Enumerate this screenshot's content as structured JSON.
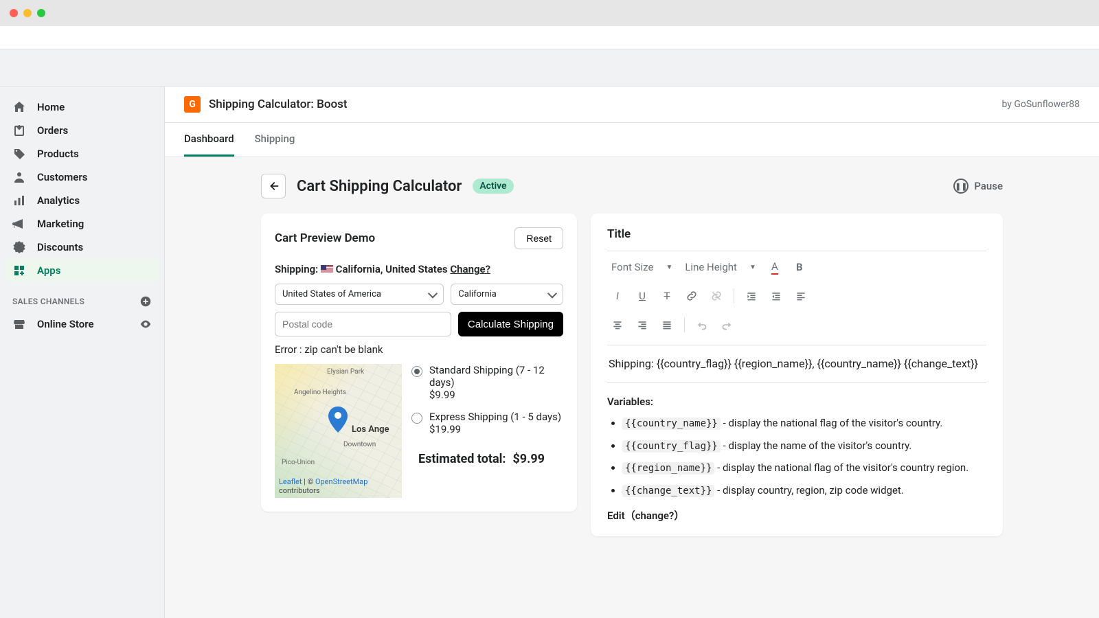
{
  "sidebar": {
    "items": [
      {
        "label": "Home"
      },
      {
        "label": "Orders"
      },
      {
        "label": "Products"
      },
      {
        "label": "Customers"
      },
      {
        "label": "Analytics"
      },
      {
        "label": "Marketing"
      },
      {
        "label": "Discounts"
      },
      {
        "label": "Apps"
      }
    ],
    "channels_header": "SALES CHANNELS",
    "channels": [
      {
        "label": "Online Store"
      }
    ]
  },
  "app": {
    "title": "Shipping Calculator: Boost",
    "by": "by GoSunflower88"
  },
  "tabs": [
    {
      "label": "Dashboard"
    },
    {
      "label": "Shipping"
    }
  ],
  "page": {
    "title": "Cart Shipping Calculator",
    "status": "Active",
    "pause": "Pause"
  },
  "preview": {
    "heading": "Cart Preview Demo",
    "reset": "Reset",
    "shipping_prefix": "Shipping:",
    "location": "California, United States",
    "change": "Change?",
    "country": "United States of America",
    "state": "California",
    "postal_placeholder": "Postal code",
    "calculate": "Calculate Shipping",
    "error": "Error : zip can't be blank",
    "options": [
      {
        "label": "Standard Shipping (7 - 12 days)",
        "price": "$9.99"
      },
      {
        "label": "Express Shipping (1 - 5 days)",
        "price": "$19.99"
      }
    ],
    "estimated_label": "Estimated total:",
    "estimated_value": "$9.99",
    "map": {
      "labels": [
        "Elysian Park",
        "Angelino Heights",
        "Los Ange",
        "Downtown",
        "Pico-Union"
      ],
      "leaflet": "Leaflet",
      "osm": "OpenStreetMap",
      "contrib": "contributors",
      "sep": " | © "
    }
  },
  "title_panel": {
    "heading": "Title",
    "font_size": "Font Size",
    "line_height": "Line Height",
    "content": "Shipping: {{country_flag}} {{region_name}}, {{country_name}} {{change_text}}",
    "vars_heading": "Variables:",
    "vars": [
      {
        "code": "{{country_name}}",
        "desc": "- display the national flag of the visitor's country."
      },
      {
        "code": "{{country_flag}}",
        "desc": "- display the name of the visitor's country."
      },
      {
        "code": "{{region_name}}",
        "desc": "- display the national flag of the visitor's country region."
      },
      {
        "code": "{{change_text}}",
        "desc": "- display country, region, zip code widget."
      }
    ],
    "edit_heading": "Edit（change?）"
  }
}
